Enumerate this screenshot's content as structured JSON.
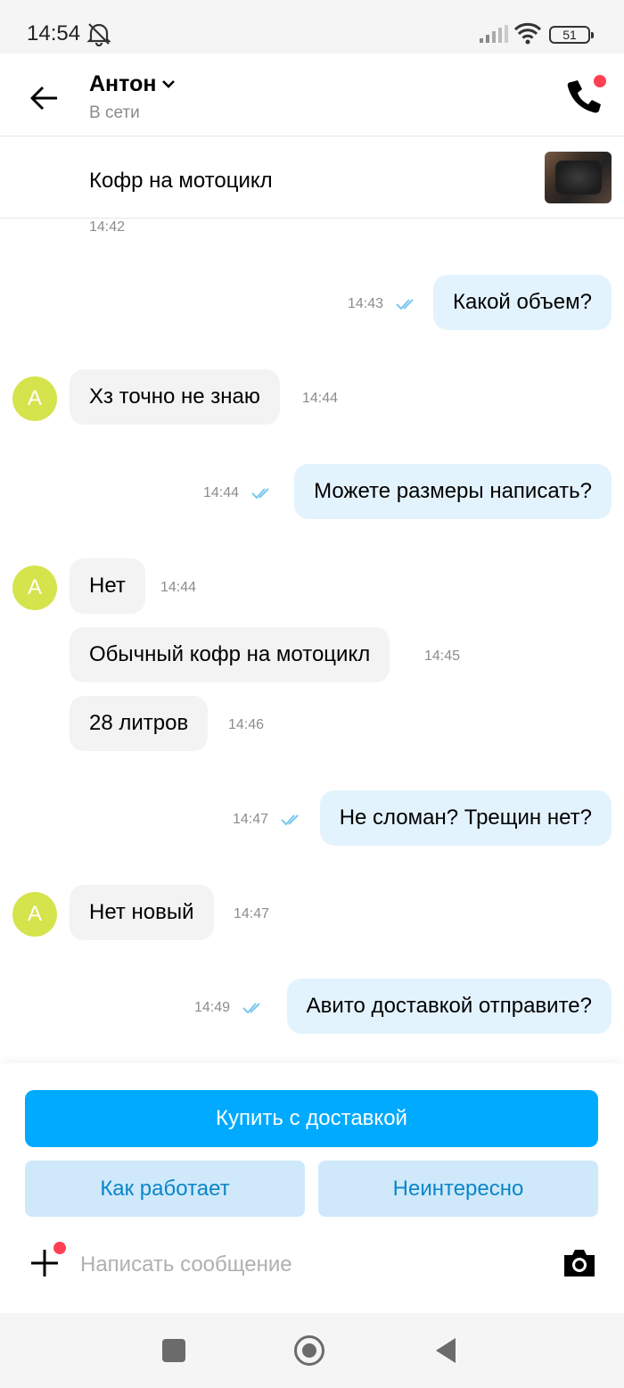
{
  "status_bar": {
    "time": "14:54",
    "battery": "51",
    "icons": [
      "alarm-off-icon",
      "signal-icon",
      "wifi-icon",
      "battery-icon"
    ]
  },
  "header": {
    "contact_name": "Антон",
    "contact_status": "В сети",
    "icons": [
      "back-arrow-icon",
      "chevron-down-icon",
      "phone-icon"
    ]
  },
  "item": {
    "title": "Кофр на мотоцикл"
  },
  "messages": {
    "top_time": "14:42",
    "items": [
      {
        "direction": "out",
        "text": "Какой объем?",
        "time": "14:43",
        "read": true
      },
      {
        "direction": "in",
        "text": "Хз точно не знаю",
        "time": "14:44",
        "avatar": "А"
      },
      {
        "direction": "out",
        "text": "Можете размеры написать?",
        "time": "14:44",
        "read": true
      },
      {
        "direction": "in",
        "text": "Нет",
        "time": "14:44",
        "avatar": "А"
      },
      {
        "direction": "in",
        "text": "Обычный кофр на мотоцикл",
        "time": "14:45"
      },
      {
        "direction": "in",
        "text": "28 литров",
        "time": "14:46"
      },
      {
        "direction": "out",
        "text": "Не сломан? Трещин нет?",
        "time": "14:47",
        "read": true
      },
      {
        "direction": "in",
        "text": "Нет новый",
        "time": "14:47",
        "avatar": "А"
      },
      {
        "direction": "out",
        "text": "Авито доставкой отправите?",
        "time": "14:49",
        "read": true
      }
    ]
  },
  "actions": {
    "buy_with_delivery": "Купить с доставкой",
    "how_it_works": "Как работает",
    "not_interested": "Неинтересно"
  },
  "composer": {
    "placeholder": "Написать сообщение",
    "value": ""
  },
  "colors": {
    "primary": "#00aaff",
    "secondary_bg": "#cfe9fb",
    "secondary_text": "#0a86c9",
    "outgoing_bubble": "#e3f3fe",
    "incoming_bubble": "#f3f3f3",
    "avatar": "#d5e34c",
    "notification_dot": "#ff4053"
  }
}
